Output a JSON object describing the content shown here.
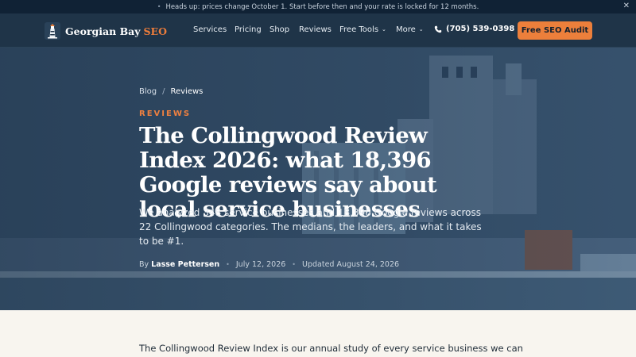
{
  "announcement": {
    "text": "Heads up: prices change October 1. Start before then and your rate is locked for 12 months.",
    "close_icon": "close-icon"
  },
  "nav": {
    "brand_primary": "Georgian Bay",
    "brand_accent": "SEO",
    "items": [
      "Services",
      "Pricing",
      "Shop",
      "Reviews",
      "Free Tools",
      "More"
    ],
    "phone": "(705) 539-0398",
    "cta": "Free SEO Audit"
  },
  "hero": {
    "breadcrumb": [
      "Blog",
      "Reviews"
    ],
    "eyebrow": "REVIEWS",
    "title": "The Collingwood Review Index 2026: what 18,396 Google reviews say about local service businesses",
    "lede": "We analyzed 348 service businesses and 18,396 Google reviews across 22 Collingwood categories. The medians, the leaders, and what it takes to be #1.",
    "by_label": "By",
    "author": "Lasse Pettersen",
    "published": "July 12, 2026",
    "updated": "Updated August 24, 2026"
  },
  "article": {
    "intro": "The Collingwood Review Index is our annual study of every service business we can"
  },
  "colors": {
    "accent": "#ec7f3b",
    "nav_bg": "#1f3448",
    "bar_bg": "#102235"
  }
}
